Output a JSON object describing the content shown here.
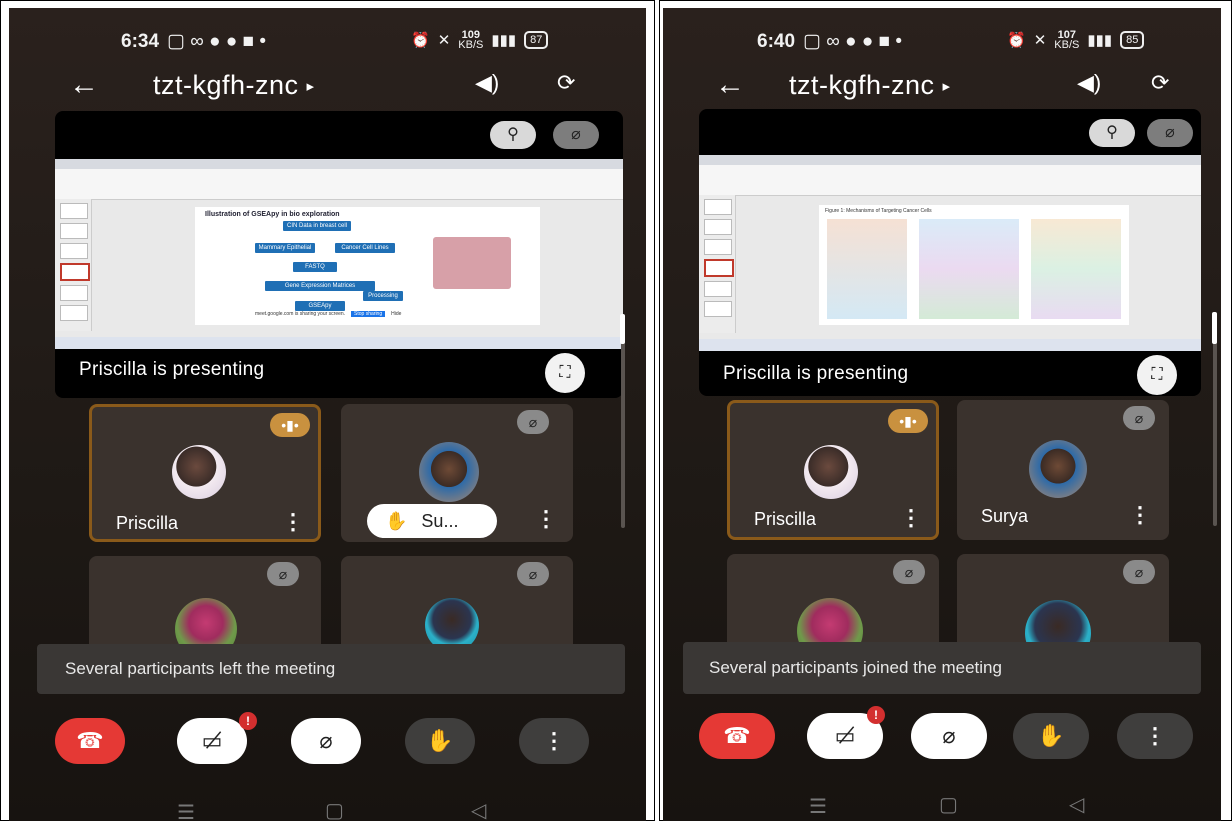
{
  "left": {
    "status": {
      "time": "6:34",
      "speed_value": "109",
      "speed_unit": "KB/S",
      "battery": "87"
    },
    "meeting_code": "tzt-kgfh-znc",
    "presenting_label": "Priscilla is presenting",
    "slide_title": "Illustration of GSEApy in bio exploration",
    "slide_boxes": [
      "CIN Data in breast cell types",
      "Mammary Epithelial Cells",
      "Cancer Cell Lines",
      "FASTQ",
      "Gene Expression Matrices",
      "Processing",
      "GSEApy"
    ],
    "sharing_bar": {
      "text": "meet.google.com is sharing your screen.",
      "stop": "Stop sharing",
      "hide": "Hide"
    },
    "tiles": [
      {
        "name": "Priscilla",
        "active": true
      },
      {
        "name": "Su...",
        "raised_hand": true
      },
      {
        "name": ""
      },
      {
        "name": ""
      }
    ],
    "toast": "Several participants left the meeting",
    "camera_badge": "!"
  },
  "right": {
    "status": {
      "time": "6:40",
      "speed_value": "107",
      "speed_unit": "KB/S",
      "battery": "85"
    },
    "meeting_code": "tzt-kgfh-znc",
    "presenting_label": "Priscilla is presenting",
    "slide_title": "Figure 1: Mechanisms of Targeting Cancer Cells",
    "tiles": [
      {
        "name": "Priscilla",
        "active": true
      },
      {
        "name": "Surya"
      },
      {
        "name": ""
      },
      {
        "name": ""
      }
    ],
    "toast": "Several participants joined the meeting",
    "camera_badge": "!"
  },
  "icons": {
    "back": "back-arrow-icon",
    "speaker": "speaker-icon",
    "switch_camera": "switch-camera-icon",
    "pin": "pin-icon",
    "mic_off": "mic-off-icon",
    "fullscreen": "fullscreen-icon",
    "end_call": "end-call-icon",
    "camera_off": "camera-off-icon",
    "raise_hand": "raise-hand-icon",
    "more": "more-vert-icon"
  },
  "colors": {
    "end_call": "#e53935",
    "speaking_border": "#8a5a1a",
    "speaking_chip": "#c9913f",
    "badge": "#d32f2f"
  }
}
